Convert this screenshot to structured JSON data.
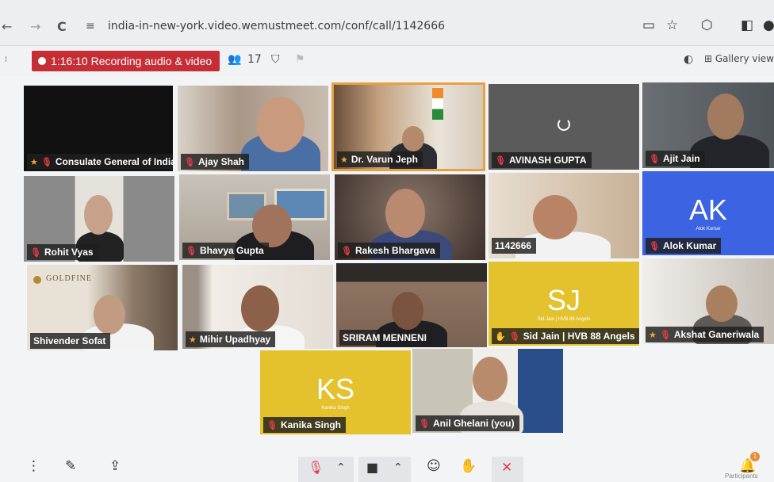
{
  "browser": {
    "back": "←",
    "forward": "→",
    "reload": "C",
    "site_icon": "≡",
    "url": "india-in-new-york.video.wemustmeet.com/conf/call/1142666"
  },
  "toolbar": {
    "recording_label": "1:16:10 Recording audio & video",
    "participant_count": "17",
    "view_label": "Gallery view"
  },
  "tiles": [
    {
      "name": "Consulate General of India",
      "icons": [
        "star",
        "mute"
      ]
    },
    {
      "name": "Ajay Shah",
      "icons": [
        "mute"
      ]
    },
    {
      "name": "Dr. Varun Jeph",
      "icons": [
        "star"
      ]
    },
    {
      "name": "AVINASH GUPTA",
      "icons": [
        "mute"
      ]
    },
    {
      "name": "Ajit Jain",
      "icons": [
        "mute"
      ]
    },
    {
      "name": "Rohit Vyas",
      "icons": [
        "mute"
      ]
    },
    {
      "name": "Bhavya Gupta",
      "icons": [
        "mute"
      ]
    },
    {
      "name": "Rakesh Bhargava",
      "icons": [
        "mute"
      ]
    },
    {
      "name": "1142666",
      "icons": []
    },
    {
      "name": "Alok Kumar",
      "icons": [
        "mute"
      ],
      "initials": "AK",
      "subtitle": "Alok Kumar"
    },
    {
      "name": "Shivender Sofat",
      "icons": []
    },
    {
      "name": "Mihir Upadhyay",
      "icons": [
        "star"
      ]
    },
    {
      "name": "SRIRAM MENNENI",
      "icons": []
    },
    {
      "name": "Sid Jain | HVB 88 Angels",
      "icons": [
        "hand",
        "mute"
      ],
      "initials": "SJ",
      "subtitle": "Sid Jain | HVB 88 Angels"
    },
    {
      "name": "Akshat Ganeriwala",
      "icons": [
        "star",
        "mute"
      ]
    },
    {
      "name": "Kanika Singh",
      "icons": [
        "mute"
      ],
      "initials": "KS",
      "subtitle": "Kanika Singh"
    },
    {
      "name": "Anil Ghelani (you)",
      "icons": [
        "mute"
      ]
    }
  ],
  "backgrounds": {
    "goldfine_logo": "GOLDFINE"
  },
  "bottom": {
    "participants_label": "Participants",
    "notification_count": "1"
  },
  "colors": {
    "recording": "#c62e36",
    "yellow_tile": "#e3c22e",
    "blue_tile": "#3a62e0",
    "active_speaker": "#e8a040"
  }
}
